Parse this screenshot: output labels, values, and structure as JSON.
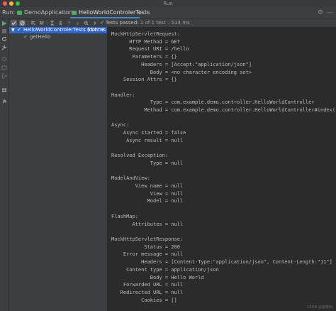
{
  "window": {
    "title": "Run"
  },
  "tabbar": {
    "run_label": "Run:",
    "tabs": [
      {
        "label": "DemoApplication",
        "close": "×"
      },
      {
        "label": "HelloWorldControlerTests",
        "close": "×"
      }
    ],
    "settings_glyph": "⚙",
    "minimize_glyph": "—"
  },
  "test_toolbar": {
    "status_check": "✔",
    "status_main": "Tests passed:",
    "status_detail": "1 of 1 test – 514 ms"
  },
  "tree": {
    "root": {
      "label": "HelloWorldControlerTests (com.e",
      "time": "514 ms"
    },
    "child": {
      "label": "getHello"
    }
  },
  "console": {
    "lines": [
      "MockHttpServletRequest:",
      "      HTTP Method = GET",
      "      Request URI = /hello",
      "       Parameters = {}",
      "          Headers = [Accept:\"application/json\"]",
      "             Body = <no character encoding set>",
      "    Session Attrs = {}",
      "",
      "Handler:",
      "             Type = com.example.demo.controller.HelloWorldController",
      "           Method = com.example.demo.controller.HelloWorldController#index()",
      "",
      "Async:",
      "    Async started = false",
      "     Async result = null",
      "",
      "Resolved Exception:",
      "             Type = null",
      "",
      "ModelAndView:",
      "        View name = null",
      "             View = null",
      "            Model = null",
      "",
      "FlashMap:",
      "       Attributes = null",
      "",
      "MockHttpServletResponse:",
      "           Status = 200",
      "    Error message = null",
      "          Headers = [Content-Type:\"application/json\", Content-Length:\"11\"]",
      "     Content type = application/json",
      "             Body = Hello World",
      "    Forwarded URL = null",
      "   Redirected URL = null",
      "          Cookies = []"
    ]
  },
  "watermark": "CSDN @蛋卷fly"
}
